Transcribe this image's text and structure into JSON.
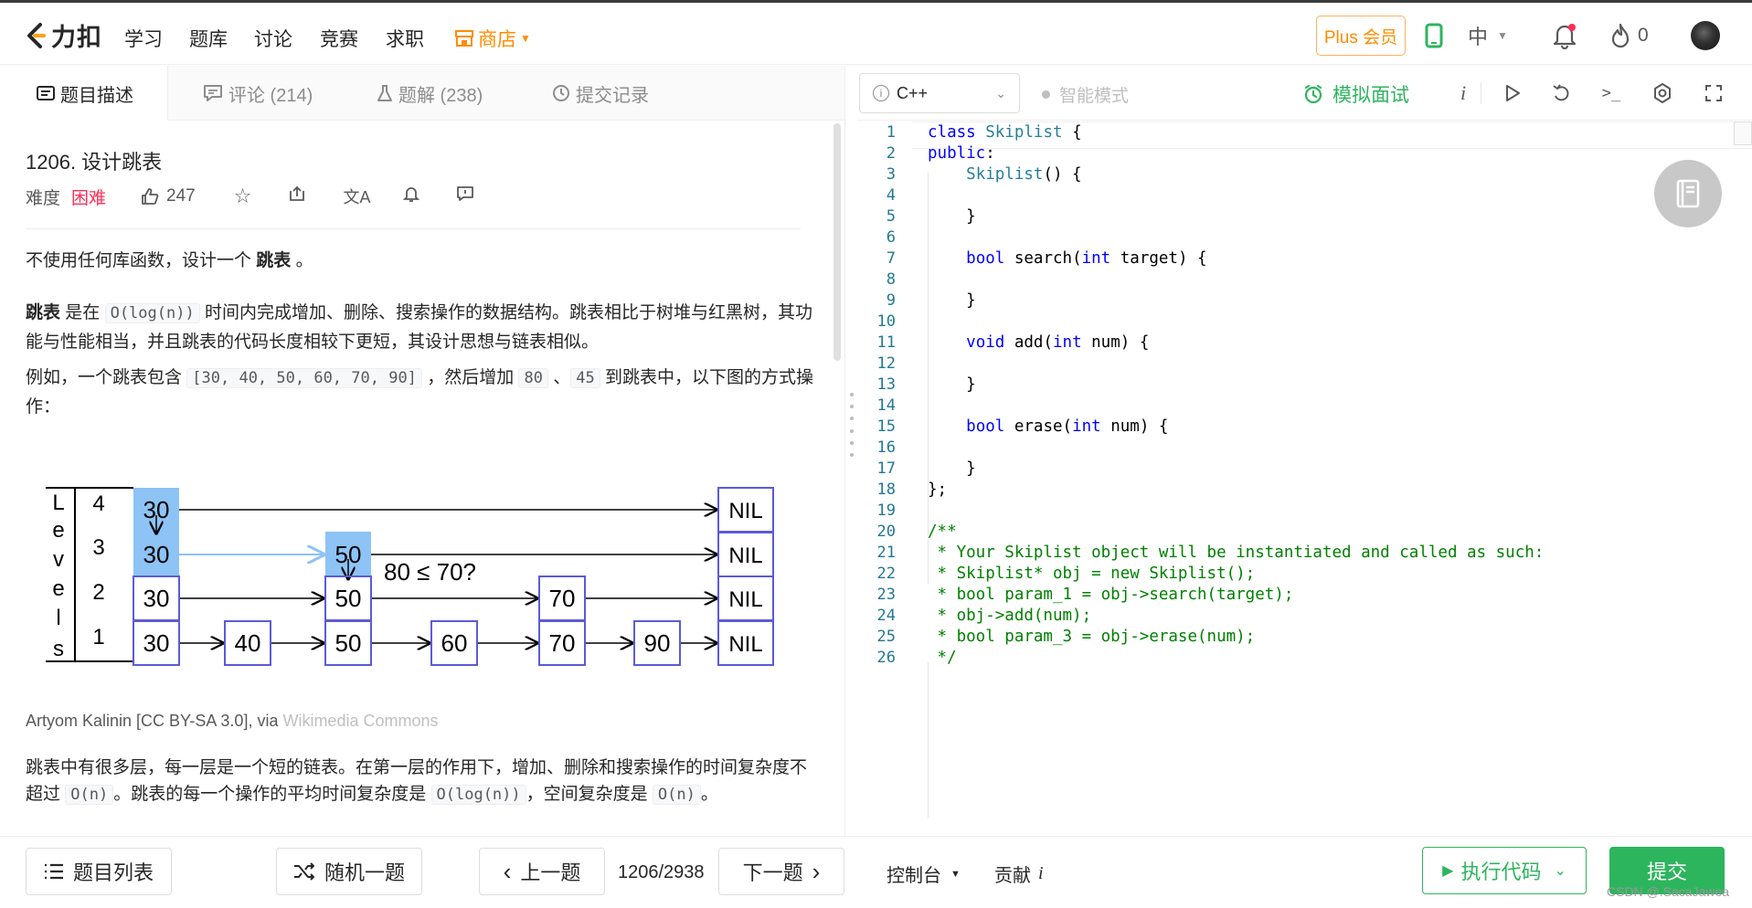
{
  "nav": {
    "logo_text": "力扣",
    "links": [
      "学习",
      "题库",
      "讨论",
      "竞赛",
      "求职"
    ],
    "shop": "商店",
    "plus": "Plus 会员",
    "lang": "中",
    "fire_count": "0"
  },
  "tabs": [
    {
      "label": "题目描述",
      "icon": "doc-icon"
    },
    {
      "label": "评论 (214)",
      "icon": "comment-icon"
    },
    {
      "label": "题解 (238)",
      "icon": "flask-icon"
    },
    {
      "label": "提交记录",
      "icon": "clock-icon"
    }
  ],
  "problem": {
    "title": "1206. 设计跳表",
    "difficulty_label": "难度",
    "difficulty": "困难",
    "likes": "247",
    "p1_a": "不使用任何库函数，设计一个 ",
    "p1_b": "跳表",
    "p1_c": " 。",
    "p2_a": "跳表",
    "p2_b": " 是在 ",
    "p2_code": "O(log(n))",
    "p2_c": " 时间内完成增加、删除、搜索操作的数据结构。跳表相比于树堆与红黑树，其功能与性能相当，并且跳表的代码长度相较下更短，其设计思想与链表相似。",
    "p3_a": "例如，一个跳表包含 ",
    "p3_code1": "[30, 40, 50, 60, 70, 90]",
    "p3_b": " ，然后增加 ",
    "p3_code2": "80",
    "p3_c": " 、",
    "p3_code3": "45",
    "p3_d": " 到跳表中，以下图的方式操作：",
    "caption_a": "Artyom Kalinin [CC BY-SA 3.0], via ",
    "caption_b": "Wikimedia Commons",
    "p4_a": "跳表中有很多层，每一层是一个短的链表。在第一层的作用下，增加、删除和搜索操作的时间复杂度不超过 ",
    "p4_code1": "O(n)",
    "p4_b": "。跳表的每一个操作的平均时间复杂度是 ",
    "p4_code2": "O(log(n))",
    "p4_c": "，空间复杂度是 ",
    "p4_code3": "O(n)",
    "p4_d": "。"
  },
  "diagram": {
    "levels_letters": [
      "L",
      "e",
      "v",
      "e",
      "l",
      "s"
    ],
    "level_numbers": [
      "4",
      "3",
      "2",
      "1"
    ],
    "nodes": {
      "l4": [
        "30",
        "NIL"
      ],
      "l3": [
        "30",
        "50",
        "NIL"
      ],
      "l2": [
        "30",
        "50",
        "70",
        "NIL"
      ],
      "l1": [
        "30",
        "40",
        "50",
        "60",
        "70",
        "90",
        "NIL"
      ]
    },
    "annotation": "80 ≤ 70?"
  },
  "toolbar": {
    "language": "C++",
    "smart_mode": "智能模式",
    "mock": "模拟面试"
  },
  "code_lines": [
    "class Skiplist {",
    "public:",
    "    Skiplist() {",
    "",
    "    }",
    "",
    "    bool search(int target) {",
    "",
    "    }",
    "",
    "    void add(int num) {",
    "",
    "    }",
    "",
    "    bool erase(int num) {",
    "",
    "    }",
    "};",
    "",
    "/**",
    " * Your Skiplist object will be instantiated and called as such:",
    " * Skiplist* obj = new Skiplist();",
    " * bool param_1 = obj->search(target);",
    " * obj->add(num);",
    " * bool param_3 = obj->erase(num);",
    " */"
  ],
  "bottom": {
    "list": "题目列表",
    "random": "随机一题",
    "prev": "上一题",
    "counter": "1206/2938",
    "next": "下一题",
    "console": "控制台",
    "contribute": "贡献",
    "run": "执行代码",
    "submit": "提交"
  },
  "watermark": "CSDN @.SacaJawea",
  "colors": {
    "accent_green": "#2db55d",
    "hard_red": "#ff2d55",
    "shop_orange": "#ff8c00",
    "node_border": "#5b5bd6",
    "node_highlight": "#8dc3f5"
  }
}
